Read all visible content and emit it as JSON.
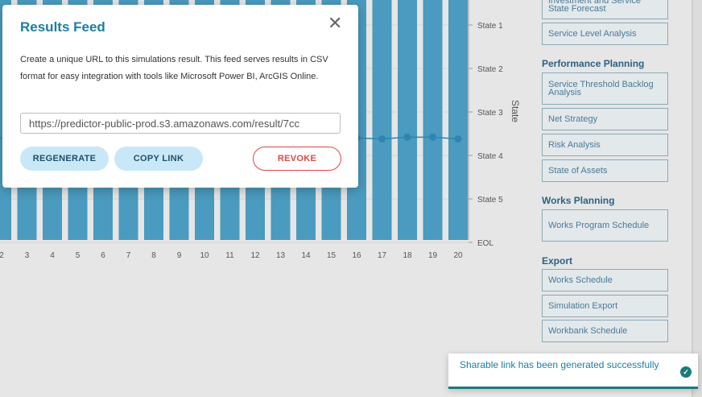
{
  "chart_data": {
    "type": "bar",
    "title": "",
    "xlabel": "",
    "y2label": "State",
    "categories": [
      "2",
      "3",
      "4",
      "5",
      "6",
      "7",
      "8",
      "9",
      "10",
      "11",
      "12",
      "13",
      "14",
      "15",
      "16",
      "17",
      "18",
      "19",
      "20"
    ],
    "values": [
      100,
      100,
      100,
      100,
      100,
      100,
      100,
      100,
      100,
      100,
      100,
      100,
      100,
      100,
      100,
      100,
      100,
      100,
      100
    ],
    "line_series": {
      "x": [
        "16",
        "17",
        "18",
        "19",
        "20"
      ],
      "y": [
        3.6,
        3.62,
        3.58,
        3.58,
        3.62
      ]
    },
    "y2_ticks": [
      "State 1",
      "State 2",
      "State 3",
      "State 4",
      "State 5",
      "EOL"
    ],
    "colors": {
      "bar": "#4a9bbf",
      "line": "#2f85ad"
    }
  },
  "sidebar": {
    "top_item_label": "Investment and Service State Forecast",
    "groups": [
      {
        "heading": "",
        "items": [
          "Service Level Analysis"
        ]
      },
      {
        "heading": "Performance Planning",
        "items": [
          "Service Threshold Backlog Analysis",
          "Net Strategy",
          "Risk Analysis",
          "State of Assets"
        ]
      },
      {
        "heading": "Works Planning",
        "items": [
          "Works Program Schedule"
        ]
      },
      {
        "heading": "Export",
        "items": [
          "Works Schedule",
          "Simulation Export",
          "Workbank Schedule"
        ]
      }
    ]
  },
  "modal": {
    "title": "Results Feed",
    "close_icon": "close-icon",
    "description": "Create a unique URL to this simulations result. This feed serves results in CSV format for easy integration with tools like Microsoft Power BI, ArcGIS Online.",
    "url_value": "https://predictor-public-prod.s3.amazonaws.com/result/7cc",
    "regenerate_label": "REGENERATE",
    "copy_label": "COPY LINK",
    "revoke_label": "REVOKE"
  },
  "toast": {
    "message": "Sharable link has been generated successfully",
    "icon": "check-circle-icon"
  }
}
